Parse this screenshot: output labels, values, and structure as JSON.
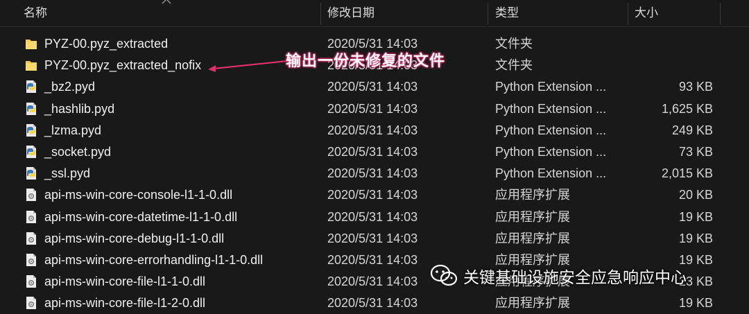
{
  "header": {
    "col_name": "名称",
    "col_date": "修改日期",
    "col_type": "类型",
    "col_size": "大小"
  },
  "files": [
    {
      "icon": "folder-icon",
      "name": "PYZ-00.pyz_extracted",
      "date": "2020/5/31 14:03",
      "type": "文件夹",
      "size": ""
    },
    {
      "icon": "folder-icon",
      "name": "PYZ-00.pyz_extracted_nofix",
      "date": "2020/5/31 14:03",
      "type": "文件夹",
      "size": ""
    },
    {
      "icon": "python-file-icon",
      "name": "_bz2.pyd",
      "date": "2020/5/31 14:03",
      "type": "Python Extension ...",
      "size": "93 KB"
    },
    {
      "icon": "python-file-icon",
      "name": "_hashlib.pyd",
      "date": "2020/5/31 14:03",
      "type": "Python Extension ...",
      "size": "1,625 KB"
    },
    {
      "icon": "python-file-icon",
      "name": "_lzma.pyd",
      "date": "2020/5/31 14:03",
      "type": "Python Extension ...",
      "size": "249 KB"
    },
    {
      "icon": "python-file-icon",
      "name": "_socket.pyd",
      "date": "2020/5/31 14:03",
      "type": "Python Extension ...",
      "size": "73 KB"
    },
    {
      "icon": "python-file-icon",
      "name": "_ssl.pyd",
      "date": "2020/5/31 14:03",
      "type": "Python Extension ...",
      "size": "2,015 KB"
    },
    {
      "icon": "dll-file-icon",
      "name": "api-ms-win-core-console-l1-1-0.dll",
      "date": "2020/5/31 14:03",
      "type": "应用程序扩展",
      "size": "20 KB"
    },
    {
      "icon": "dll-file-icon",
      "name": "api-ms-win-core-datetime-l1-1-0.dll",
      "date": "2020/5/31 14:03",
      "type": "应用程序扩展",
      "size": "19 KB"
    },
    {
      "icon": "dll-file-icon",
      "name": "api-ms-win-core-debug-l1-1-0.dll",
      "date": "2020/5/31 14:03",
      "type": "应用程序扩展",
      "size": "19 KB"
    },
    {
      "icon": "dll-file-icon",
      "name": "api-ms-win-core-errorhandling-l1-1-0.dll",
      "date": "2020/5/31 14:03",
      "type": "应用程序扩展",
      "size": "19 KB"
    },
    {
      "icon": "dll-file-icon",
      "name": "api-ms-win-core-file-l1-1-0.dll",
      "date": "2020/5/31 14:03",
      "type": "应用程序扩展",
      "size": "23 KB"
    },
    {
      "icon": "dll-file-icon",
      "name": "api-ms-win-core-file-l1-2-0.dll",
      "date": "2020/5/31 14:03",
      "type": "应用程序扩展",
      "size": "19 KB"
    }
  ],
  "annotation": {
    "text": "输出一份未修复的文件",
    "color": "#e0306a"
  },
  "watermark": {
    "icon": "wechat-icon",
    "text": "关键基础设施安全应急响应中心"
  },
  "colors": {
    "background": "#191919",
    "folder": "#f2c94c",
    "python_blue": "#3c78b5",
    "python_yellow": "#f6d545"
  }
}
